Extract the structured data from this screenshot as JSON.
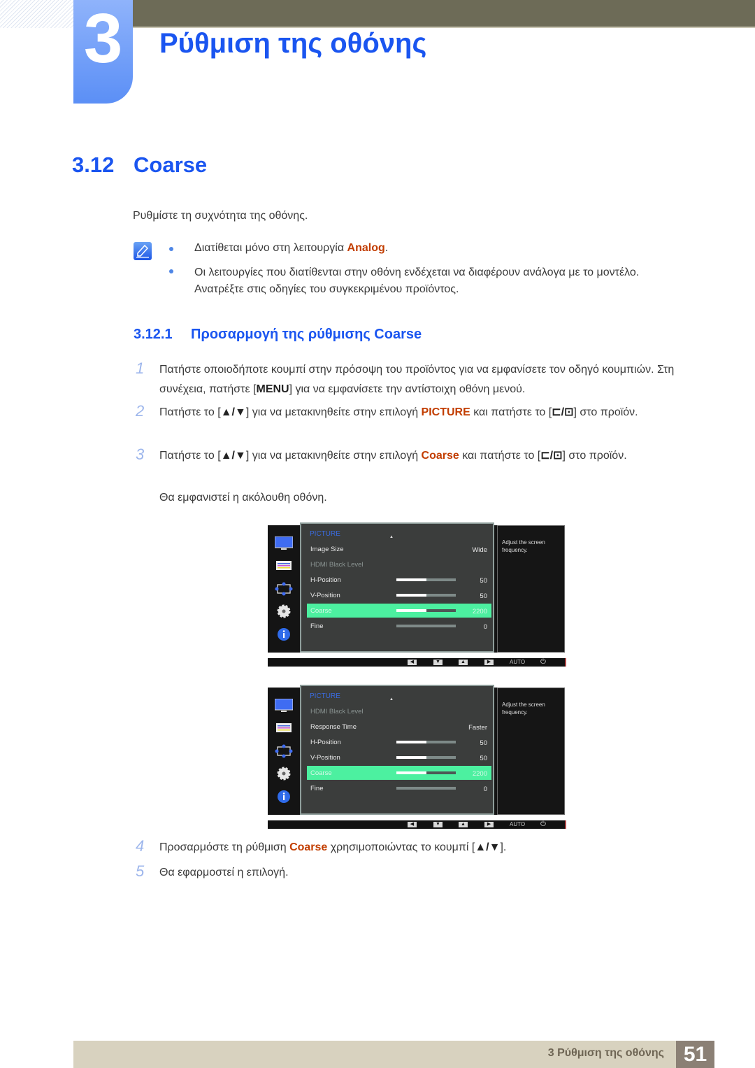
{
  "header": {
    "chapter_number": "3",
    "chapter_title": "Ρύθμιση της οθόνης"
  },
  "section": {
    "number": "3.12",
    "title": "Coarse",
    "intro": "Ρυθμίστε τη συχνότητα της οθόνης."
  },
  "notes": {
    "icon": "note-pencil-icon",
    "items": [
      {
        "text": "Διατίθεται μόνο στη λειτουργία ",
        "highlight": "Analog",
        "suffix": "."
      },
      {
        "text": "Οι λειτουργίες που διατίθενται στην οθόνη ενδέχεται να διαφέρουν ανάλογα με το μοντέλο. Ανατρέξτε στις οδηγίες του συγκεκριμένου προϊόντος."
      }
    ]
  },
  "subsection": {
    "number": "3.12.1",
    "title": "Προσαρμογή της ρύθμισης Coarse"
  },
  "steps": [
    {
      "num": "1",
      "parts": [
        "Πατήστε οποιοδήποτε κουμπί στην πρόσοψη του προϊόντος για να εμφανίσετε τον οδηγό κουμπιών. Στη συνέχεια, πατήστε [",
        "MENU",
        "] για να εμφανίσετε την αντίστοιχη οθόνη μενού."
      ]
    },
    {
      "num": "2",
      "parts": [
        "Πατήστε το [",
        "▲/▼",
        "] για να μετακινηθείτε στην επιλογή ",
        "PICTURE",
        " και πατήστε το [",
        "⊏/⊡",
        "] στο προϊόν."
      ]
    },
    {
      "num": "3",
      "parts": [
        "Πατήστε το [",
        "▲/▼",
        "] για να μετακινηθείτε στην επιλογή ",
        "Coarse",
        " και πατήστε το [",
        "⊏/⊡",
        "] στο προϊόν."
      ],
      "after": "Θα εμφανιστεί η ακόλουθη οθόνη."
    },
    {
      "num": "4",
      "parts": [
        "Προσαρμόστε τη ρύθμιση ",
        "Coarse",
        " χρησιμοποιώντας το κουμπί [",
        "▲/▼",
        "]."
      ]
    },
    {
      "num": "5",
      "parts": [
        "Θα εφαρμοστεί η επιλογή."
      ]
    }
  ],
  "osd_screens": [
    {
      "menu_title": "PICTURE",
      "help_text": "Adjust the screen frequency.",
      "rows": [
        {
          "label": "Image Size",
          "value": "Wide",
          "dim": false,
          "selected": false
        },
        {
          "label": "HDMI Black Level",
          "value": "",
          "dim": true,
          "selected": false
        },
        {
          "label": "H-Position",
          "value": "50",
          "bar": 0.5,
          "selected": false
        },
        {
          "label": "V-Position",
          "value": "50",
          "bar": 0.5,
          "selected": false
        },
        {
          "label": "Coarse",
          "value": "2200",
          "bar": 0.5,
          "selected": true
        },
        {
          "label": "Fine",
          "value": "0",
          "bar": 0,
          "selected": false
        }
      ]
    },
    {
      "menu_title": "PICTURE",
      "help_text": "Adjust the screen frequency.",
      "rows": [
        {
          "label": "HDMI Black Level",
          "value": "",
          "dim": true,
          "selected": false
        },
        {
          "label": "Response Time",
          "value": "Faster",
          "selected": false
        },
        {
          "label": "H-Position",
          "value": "50",
          "bar": 0.5,
          "selected": false
        },
        {
          "label": "V-Position",
          "value": "50",
          "bar": 0.5,
          "selected": false
        },
        {
          "label": "Coarse",
          "value": "2200",
          "bar": 0.5,
          "selected": true
        },
        {
          "label": "Fine",
          "value": "0",
          "bar": 0,
          "selected": false
        }
      ]
    }
  ],
  "osd_buttons": {
    "left": "◀",
    "down": "▼",
    "up": "▲",
    "right": "▶",
    "auto": "AUTO",
    "power": "⏻"
  },
  "osd_side_icons": [
    "picture-icon",
    "color-icon",
    "size-position-icon",
    "setup-icon",
    "information-icon"
  ],
  "footer": {
    "chapter_label": "3 Ρύθμιση της οθόνης",
    "page_number": "51"
  },
  "colors": {
    "heading_blue": "#1a55f0",
    "highlight_orange": "#c23d00",
    "osd_selected": "#4cf0a0",
    "header_bar": "#6d6b57",
    "footer_band": "#d8d2bf",
    "page_box": "#8b8075"
  }
}
